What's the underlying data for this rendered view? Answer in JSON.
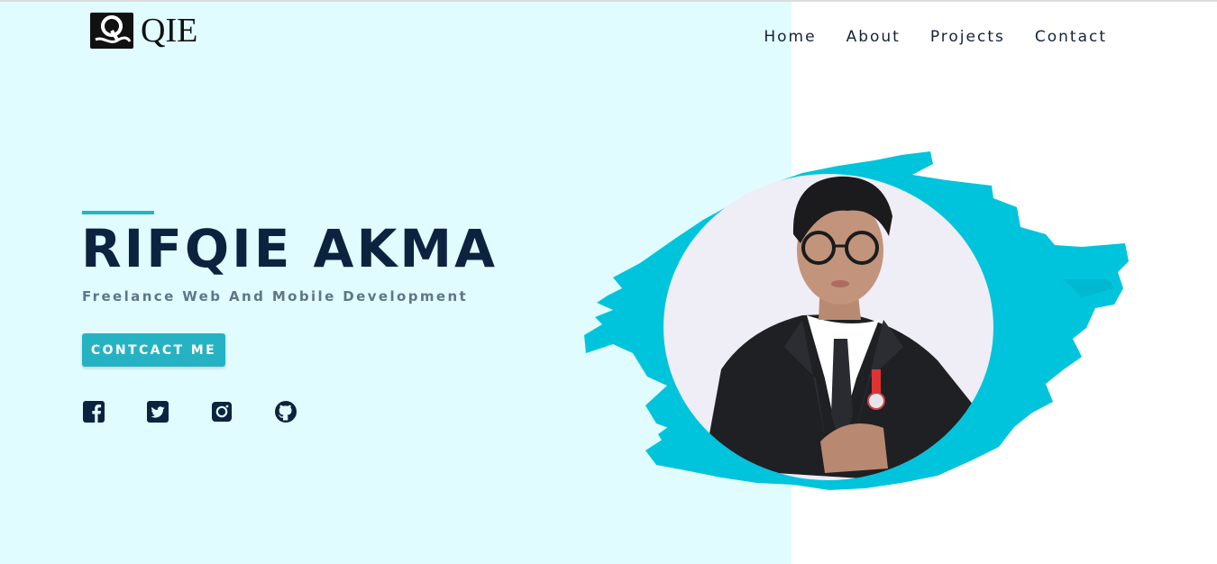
{
  "brand": {
    "logo_text": "QIE",
    "logo_icon": "q-logo-icon"
  },
  "nav": {
    "items": [
      {
        "label": "Home"
      },
      {
        "label": "About"
      },
      {
        "label": "Projects"
      },
      {
        "label": "Contact"
      }
    ]
  },
  "hero": {
    "name": "RIFQIE AKMA",
    "subtitle": "Freelance Web And Mobile Development",
    "cta_label": "CONTCACT ME",
    "socials": [
      {
        "icon": "facebook-icon"
      },
      {
        "icon": "twitter-icon"
      },
      {
        "icon": "instagram-icon"
      },
      {
        "icon": "github-icon"
      }
    ],
    "portrait_icon": "profile-photo"
  },
  "colors": {
    "left_background": "#e1fcfe",
    "accent": "#25b3c3",
    "brush": "#00c4dc",
    "heading": "#0c2340",
    "subtitle": "#5e7788"
  }
}
